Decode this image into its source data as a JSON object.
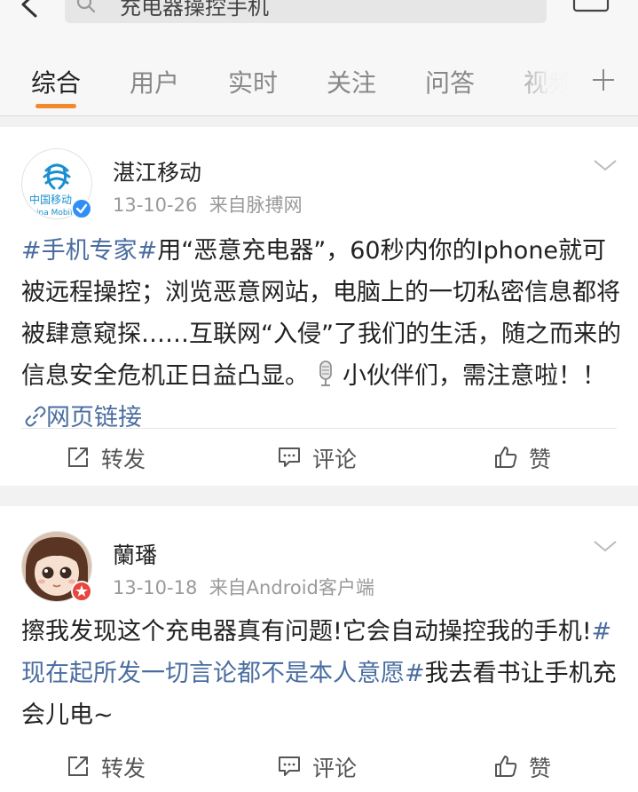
{
  "search": {
    "query": "充电器操控手机"
  },
  "tabs": [
    {
      "label": "综合",
      "active": true
    },
    {
      "label": "用户"
    },
    {
      "label": "实时"
    },
    {
      "label": "关注"
    },
    {
      "label": "问答"
    },
    {
      "label": "视频"
    }
  ],
  "posts": [
    {
      "avatar_text": "中国移动",
      "avatar_subtext": "China Mobile",
      "username": "湛江移动",
      "date": "13-10-26",
      "source": "来自脉搏网",
      "content": {
        "hashtag": "#手机专家#",
        "text1": "用“恶意充电器”，60秒内你的Iphone就可被远程操控；浏览恶意网站，电脑上的一切私密信息都将被肆意窥探……互联网“入侵”了我们的生活，随之而来的信息安全危机正日益凸显。",
        "text2": "小伙伴们，需注意啦！！",
        "link": "网页链接"
      },
      "actions": {
        "repost": "转发",
        "comment": "评论",
        "like": "赞"
      }
    },
    {
      "username": "蘭璠",
      "date": "13-10-18",
      "source": "来自Android客户端",
      "content": {
        "text1": "擦我发现这个充电器真有问题!它会自动操控我的手机!",
        "hashtag": "#现在起所发一切言论都不是本人意愿#",
        "text2": "我去看书让手机充会儿电~"
      },
      "actions": {
        "repost": "转发",
        "comment": "评论",
        "like": "赞"
      }
    }
  ],
  "colors": {
    "accent": "#f08a2c",
    "link": "#4a6da0",
    "background": "#f2f2f2",
    "card": "#ffffff"
  },
  "icons": [
    "back-icon",
    "search-icon",
    "compose-icon",
    "plus-icon",
    "chevron-down-icon",
    "microphone-icon",
    "link-icon",
    "repost-icon",
    "comment-icon",
    "like-icon",
    "verified-icon"
  ]
}
